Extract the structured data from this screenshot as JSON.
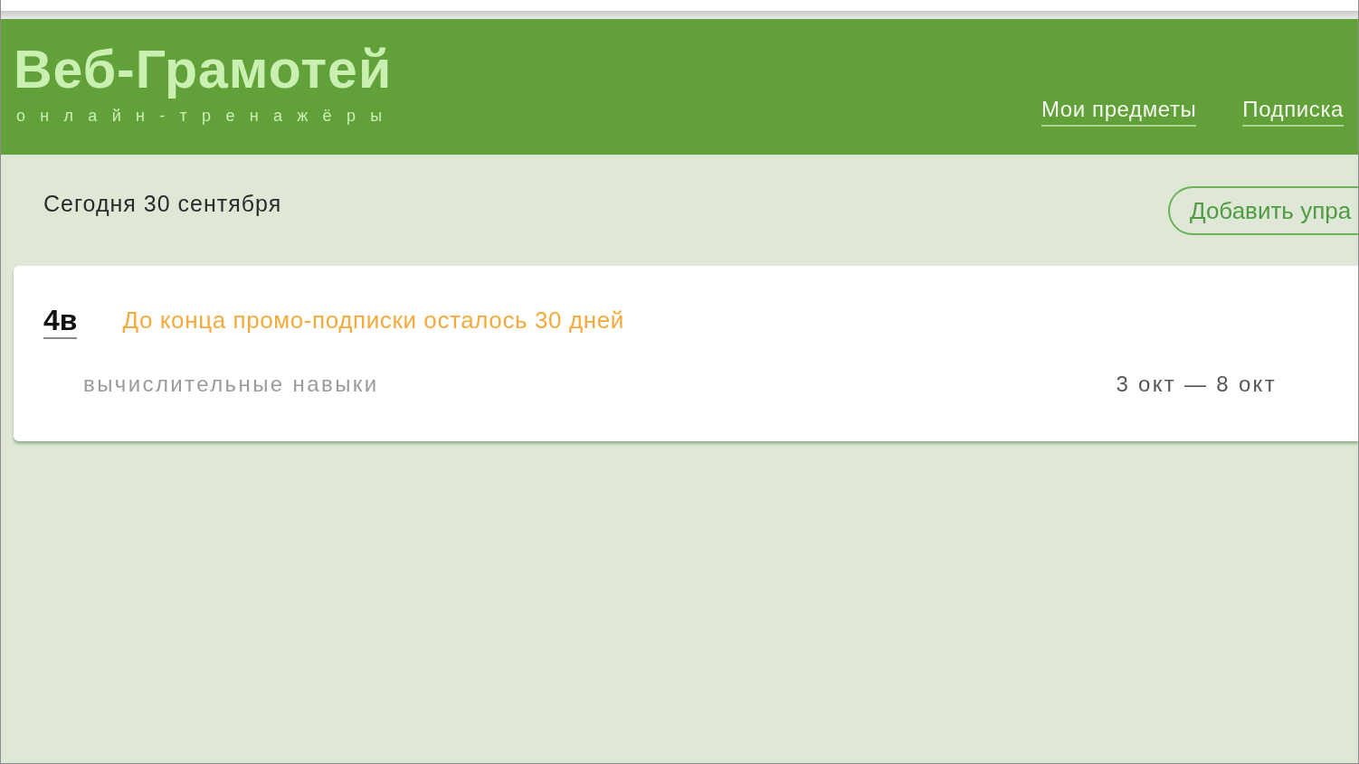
{
  "header": {
    "logo": "Веб-Грамотей",
    "tagline": "онлайн-тренажёры",
    "nav": [
      {
        "label": "Мои предметы"
      },
      {
        "label": "Подписка"
      }
    ]
  },
  "toolbar": {
    "date": "Сегодня 30 сентября",
    "add_button": "Добавить упра"
  },
  "classes": [
    {
      "name": "4в",
      "notice": "До конца промо-подписки осталось 30 дней",
      "subjects": [
        {
          "name": "вычислительные навыки",
          "dates": "3 окт — 8 окт"
        }
      ]
    }
  ]
}
